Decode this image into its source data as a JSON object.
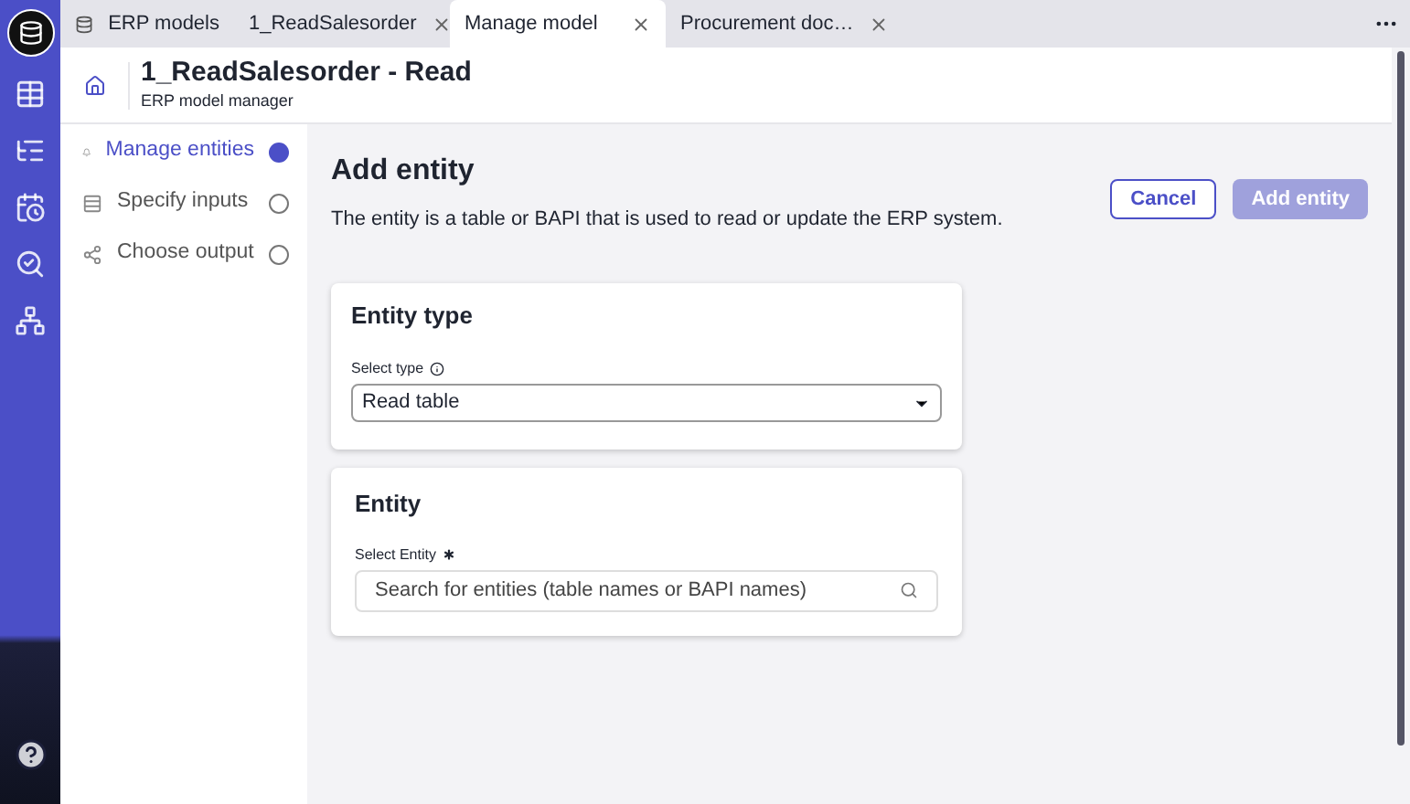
{
  "tabs": [
    {
      "label": "ERP models",
      "kind": "home",
      "selected": false
    },
    {
      "label": "1_ReadSalesorder",
      "kind": "document",
      "selected": false
    },
    {
      "label": "Manage model",
      "kind": "document",
      "selected": true
    },
    {
      "label": "Procurement doc…",
      "kind": "document",
      "selected": false
    }
  ],
  "header": {
    "title": "1_ReadSalesorder - Read",
    "subtitle": "ERP model manager"
  },
  "steps": [
    {
      "label": "Manage entities",
      "kind": "entities",
      "selected": true
    },
    {
      "label": "Specify inputs",
      "kind": "inputs",
      "selected": false
    },
    {
      "label": "Choose output",
      "kind": "output",
      "selected": false
    }
  ],
  "page": {
    "title": "Add entity",
    "description": "The entity is a table or BAPI that is used to read or update the ERP system.",
    "buttons": [
      {
        "label": "Cancel",
        "disabled": false
      },
      {
        "label": "Add entity",
        "disabled": true
      }
    ]
  },
  "entity_type": {
    "title": "Entity type",
    "label": "Select type",
    "value": "Read table"
  },
  "entity": {
    "title": "Entity",
    "label": "Select Entity",
    "required": true,
    "placeholder": "Search for entities (table names or BAPI names)"
  }
}
